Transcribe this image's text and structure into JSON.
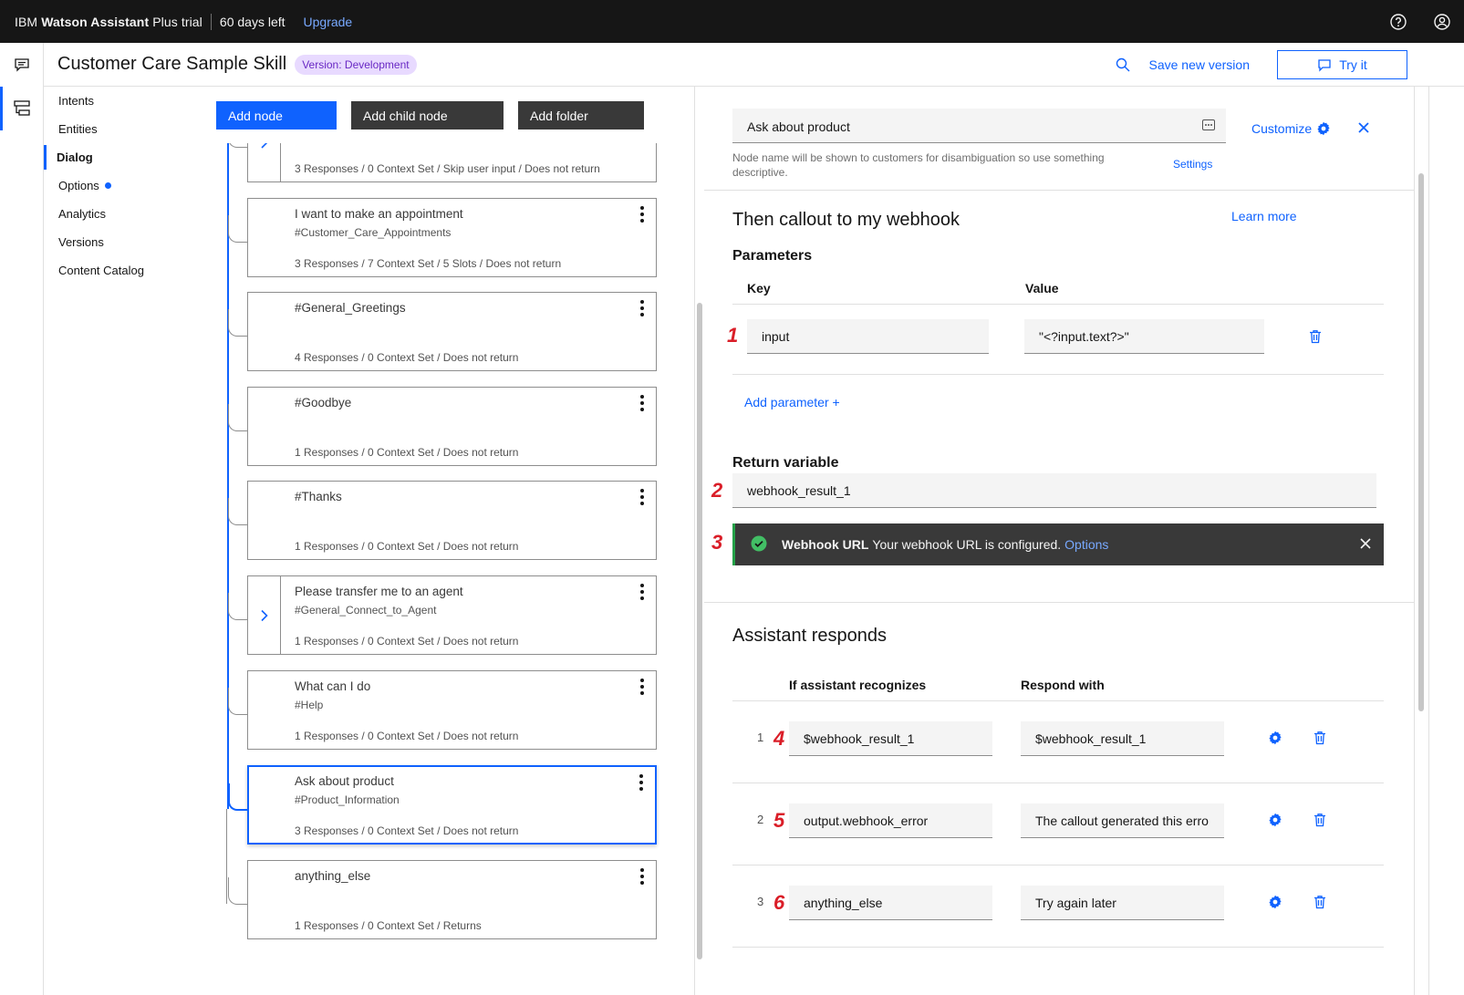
{
  "topbar": {
    "brand_prefix": "IBM ",
    "brand_name": "Watson Assistant",
    "brand_suffix": " Plus trial",
    "days_left": "60 days left",
    "upgrade": "Upgrade"
  },
  "header": {
    "skill_title": "Customer Care Sample Skill",
    "version_tag": "Version: Development",
    "save_version": "Save new version",
    "try_it": "Try it"
  },
  "nav": {
    "items": [
      "Intents",
      "Entities",
      "Dialog",
      "Options",
      "Analytics",
      "Versions",
      "Content Catalog"
    ],
    "active": "Dialog"
  },
  "toolbar": {
    "add_node": "Add node",
    "add_child_node": "Add child node",
    "add_folder": "Add folder"
  },
  "tree": {
    "nodes": [
      {
        "title": "",
        "sub": "",
        "meta": "3 Responses / 0 Context Set / Skip user input / Does not return",
        "expander": true
      },
      {
        "title": "I want to make an appointment",
        "sub": "#Customer_Care_Appointments",
        "meta": "3 Responses / 7 Context Set / 5 Slots / Does not return",
        "expander": false
      },
      {
        "title": "#General_Greetings",
        "sub": "",
        "meta": "4 Responses / 0 Context Set / Does not return",
        "expander": false
      },
      {
        "title": "#Goodbye",
        "sub": "",
        "meta": "1 Responses / 0 Context Set / Does not return",
        "expander": false
      },
      {
        "title": "#Thanks",
        "sub": "",
        "meta": "1 Responses / 0 Context Set / Does not return",
        "expander": false
      },
      {
        "title": "Please transfer me to an agent",
        "sub": "#General_Connect_to_Agent",
        "meta": "1 Responses / 0 Context Set / Does not return",
        "expander": true
      },
      {
        "title": "What can I do",
        "sub": "#Help",
        "meta": "1 Responses / 0 Context Set / Does not return",
        "expander": false
      },
      {
        "title": "Ask about product",
        "sub": "#Product_Information",
        "meta": "3 Responses / 0 Context Set / Does not return",
        "expander": false,
        "selected": true
      },
      {
        "title": "anything_else",
        "sub": "",
        "meta": "1 Responses / 0 Context Set / Returns",
        "expander": false
      }
    ]
  },
  "editor": {
    "node_name": "Ask about product",
    "node_name_help": "Node name will be shown to customers for disambiguation so use something descriptive.",
    "settings": "Settings",
    "customize": "Customize",
    "callout_title": "Then callout to my webhook",
    "learn_more": "Learn more",
    "parameters": "Parameters",
    "key_header": "Key",
    "value_header": "Value",
    "param_key": "input",
    "param_value": "\"<?input.text?>\"",
    "add_parameter": "Add parameter",
    "return_variable": "Return variable",
    "return_value": "webhook_result_1",
    "notification": {
      "title": "Webhook URL",
      "text": "Your webhook URL is configured.",
      "link": "Options"
    },
    "assistant_responds": "Assistant responds",
    "recognizes_header": "If assistant recognizes",
    "respond_header": "Respond with",
    "responses": [
      {
        "num": "1",
        "condition": "$webhook_result_1",
        "response": "$webhook_result_1"
      },
      {
        "num": "2",
        "condition": "output.webhook_error",
        "response": "The callout generated this erro"
      },
      {
        "num": "3",
        "condition": "anything_else",
        "response": "Try again later"
      }
    ]
  },
  "annotations": [
    "1",
    "2",
    "3",
    "4",
    "5",
    "6"
  ],
  "colors": {
    "accent": "#0f62fe",
    "topbar": "#161616",
    "success": "#24a148",
    "annotation": "#da1e28",
    "tag_bg": "#e8daff",
    "tag_fg": "#6929c4"
  }
}
